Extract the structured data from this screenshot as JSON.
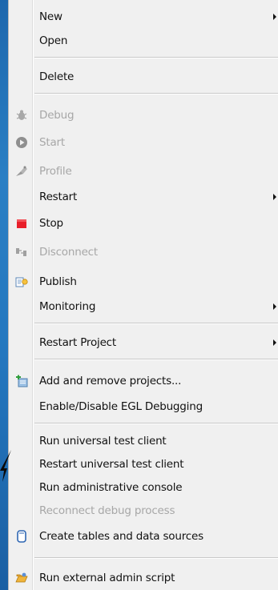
{
  "menu": {
    "items": [
      {
        "label": "New",
        "enabled": true,
        "submenu": true
      },
      {
        "label": "Open",
        "enabled": true
      },
      {
        "label": "Delete",
        "enabled": true
      },
      {
        "label": "Debug",
        "enabled": false,
        "icon": "debug-icon"
      },
      {
        "label": "Start",
        "enabled": false,
        "icon": "start-icon"
      },
      {
        "label": "Profile",
        "enabled": false,
        "icon": "profile-icon"
      },
      {
        "label": "Restart",
        "enabled": true,
        "submenu": true
      },
      {
        "label": "Stop",
        "enabled": true,
        "icon": "stop-icon"
      },
      {
        "label": "Disconnect",
        "enabled": false,
        "icon": "disconnect-icon"
      },
      {
        "label": "Publish",
        "enabled": true,
        "icon": "publish-icon"
      },
      {
        "label": "Monitoring",
        "enabled": true,
        "submenu": true
      },
      {
        "label": "Restart Project",
        "enabled": true,
        "submenu": true
      },
      {
        "label": "Add and remove projects...",
        "enabled": true,
        "icon": "add-remove-projects-icon"
      },
      {
        "label": "Enable/Disable EGL Debugging",
        "enabled": true
      },
      {
        "label": "Run universal test client",
        "enabled": true
      },
      {
        "label": "Restart universal test client",
        "enabled": true
      },
      {
        "label": "Run administrative console",
        "enabled": true
      },
      {
        "label": "Reconnect debug process",
        "enabled": false
      },
      {
        "label": "Create tables and data sources",
        "enabled": true,
        "icon": "database-icon"
      },
      {
        "label": "Run external admin script",
        "enabled": true,
        "icon": "script-icon"
      }
    ]
  },
  "colors": {
    "desktop": "#2477bf",
    "menu_background": "#f0f0f0",
    "text": "#111111",
    "disabled_text": "#a7a7a7",
    "stop_red": "#e81f2a"
  }
}
